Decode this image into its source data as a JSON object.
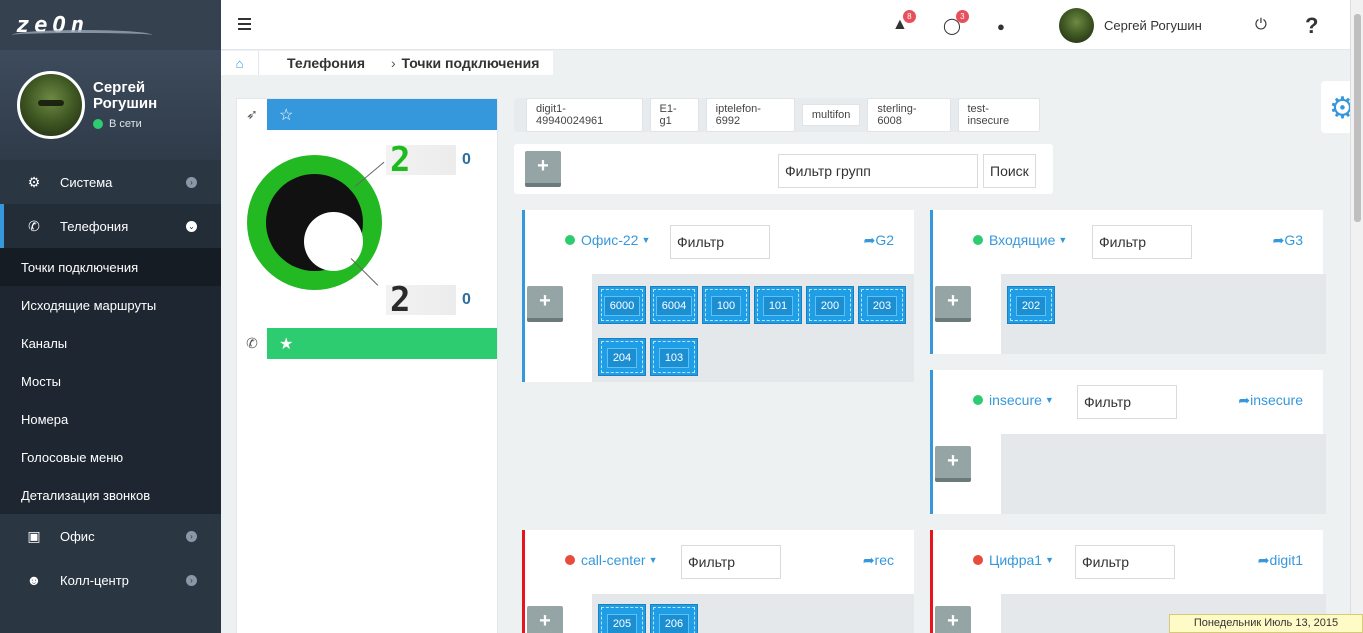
{
  "logo": "zeOn",
  "user": {
    "name": "Сергей Рогушин",
    "status": "В сети"
  },
  "sidebar": {
    "items": [
      {
        "label": "Система",
        "icon": "gears-icon"
      },
      {
        "label": "Телефония",
        "icon": "phone-icon",
        "active": true
      },
      {
        "label": "Офис",
        "icon": "briefcase-icon"
      },
      {
        "label": "Колл-центр",
        "icon": "users-icon"
      }
    ],
    "subitems": [
      "Точки подключения",
      "Исходящие маршруты",
      "Каналы",
      "Мосты",
      "Номера",
      "Голосовые меню",
      "Детализация звонков"
    ]
  },
  "header": {
    "alerts_count": "8",
    "messages_count": "3",
    "user_name": "Сергей Рогушин",
    "help": "?"
  },
  "breadcrumb": {
    "section": "Телефония",
    "page": "Точки подключения"
  },
  "stats": {
    "top_big": "2",
    "top_small": "0",
    "bottom_big": "2",
    "bottom_small": "0"
  },
  "tags": [
    "digit1-49940024961",
    "E1-g1",
    "iptelefon-6992",
    "multifon",
    "sterling-6008",
    "test-insecure"
  ],
  "group_filter": {
    "placeholder": "Фильтр групп",
    "search_label": "Поиск"
  },
  "cards": [
    {
      "name": "Офис-22",
      "filter": "Фильтр",
      "link": "G2",
      "status": "green",
      "exts": [
        "6000",
        "6004",
        "100",
        "101",
        "200",
        "203",
        "204",
        "103"
      ]
    },
    {
      "name": "Входящие",
      "filter": "Фильтр",
      "link": "G3",
      "status": "green",
      "exts": [
        "202"
      ]
    },
    {
      "name": "insecure",
      "filter": "Фильтр",
      "link": "insecure",
      "status": "green",
      "exts": []
    },
    {
      "name": "call-center",
      "filter": "Фильтр",
      "link": "rec",
      "status": "red",
      "exts": [
        "205",
        "206"
      ]
    },
    {
      "name": "Цифра1",
      "filter": "Фильтр",
      "link": "digit1",
      "status": "red",
      "exts": []
    }
  ],
  "date": "Понедельник Июль 13, 2015",
  "colors": {
    "accent": "#3598dc",
    "green": "#2ecc71",
    "red": "#e7141b",
    "sidebar": "#2b3643"
  }
}
